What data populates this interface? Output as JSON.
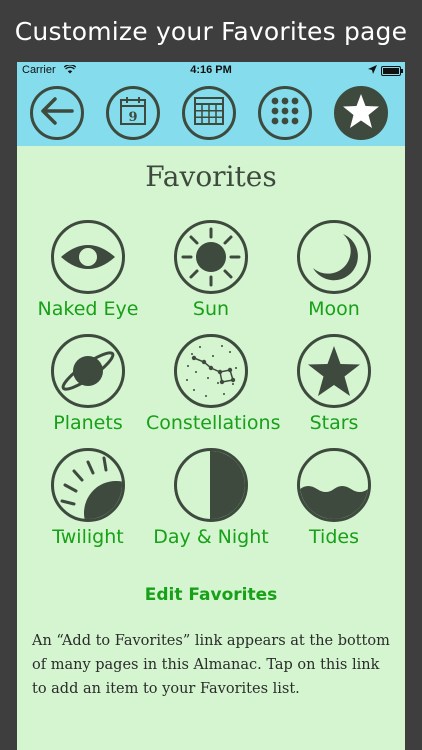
{
  "caption": "Customize your Favorites page",
  "status_bar": {
    "carrier": "Carrier",
    "time": "4:16 PM",
    "battery_level": 1.0
  },
  "toolbar": {
    "buttons": [
      {
        "icon": "back-arrow-icon"
      },
      {
        "icon": "calendar-day-icon",
        "text": "9"
      },
      {
        "icon": "calendar-grid-icon"
      },
      {
        "icon": "dots-grid-icon"
      },
      {
        "icon": "star-icon",
        "active": true
      }
    ]
  },
  "page": {
    "title": "Favorites",
    "favorites": [
      {
        "label": "Naked Eye",
        "icon": "eye-icon"
      },
      {
        "label": "Sun",
        "icon": "sun-icon"
      },
      {
        "label": "Moon",
        "icon": "moon-icon"
      },
      {
        "label": "Planets",
        "icon": "planet-icon"
      },
      {
        "label": "Constellations",
        "icon": "constellation-icon"
      },
      {
        "label": "Stars",
        "icon": "star-icon"
      },
      {
        "label": "Twilight",
        "icon": "twilight-icon"
      },
      {
        "label": "Day & Night",
        "icon": "day-night-icon"
      },
      {
        "label": "Tides",
        "icon": "tides-icon"
      }
    ],
    "edit_label": "Edit Favorites",
    "info_text": "An “Add to Favorites” link appears at the bottom of many pages in this Almanac. Tap on this link to add an item to your Favorites list."
  },
  "colors": {
    "toolbar_bg": "#84dcec",
    "page_bg": "#d4f5d0",
    "icon_dark": "#3d4a3d",
    "link_green": "#18a018"
  }
}
